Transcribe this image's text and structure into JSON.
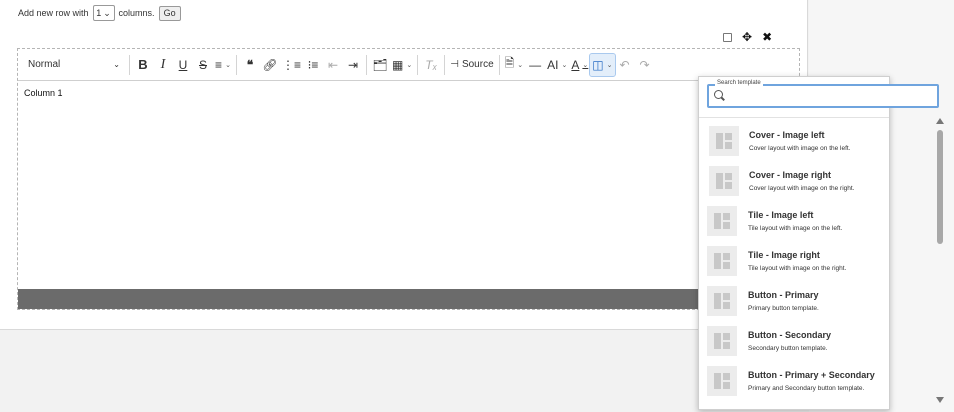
{
  "add_row": {
    "prefix": "Add new row with",
    "count": "1",
    "suffix": "columns.",
    "go_label": "Go"
  },
  "toolbar": {
    "style_value": "Normal",
    "bold": "B",
    "italic": "I",
    "underline": "U",
    "strike": "S",
    "source_label": "Source",
    "font_size": "AI",
    "font_color": "A"
  },
  "content": {
    "column_text": "Column 1"
  },
  "template_search": {
    "legend": "Search template",
    "value": "",
    "items": [
      {
        "title": "Cover - Image left",
        "desc": "Cover layout with image on the left."
      },
      {
        "title": "Cover - Image right",
        "desc": "Cover layout with image on the right."
      },
      {
        "title": "Tile - Image left",
        "desc": "Tile layout with image on the left."
      },
      {
        "title": "Tile - Image right",
        "desc": "Tile layout with image on the right."
      },
      {
        "title": "Button - Primary",
        "desc": "Primary button template."
      },
      {
        "title": "Button - Secondary",
        "desc": "Secondary button template."
      },
      {
        "title": "Button - Primary + Secondary",
        "desc": "Primary and Secondary button template."
      }
    ]
  },
  "colors": {
    "accent": "#6fa4de",
    "footer_bar": "#6b6b6b"
  }
}
